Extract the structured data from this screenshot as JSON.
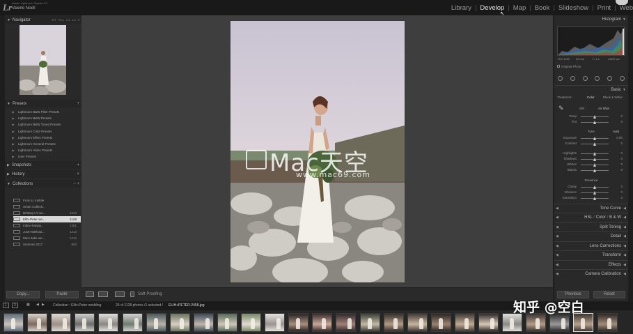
{
  "app": {
    "logo": "Lr",
    "version": "Adobe Lightroom Classic CC",
    "user": "Valerie Noell"
  },
  "modules": [
    "Library",
    "Develop",
    "Map",
    "Book",
    "Slideshow",
    "Print",
    "Web"
  ],
  "active_module": "Develop",
  "left_panel": {
    "navigator": {
      "title": "Navigator",
      "zoom": [
        "FIT",
        "FILL",
        "1:1",
        "4:1",
        "▾"
      ]
    },
    "presets": {
      "title": "Presets",
      "items": [
        "Lightroom B&W Filter Presets",
        "Lightroom B&W Presets",
        "Lightroom B&W Toned Presets",
        "Lightroom Color Presets",
        "Lightroom Effect Presets",
        "Lightroom General Presets",
        "Lightroom Video Presets",
        "User Presets"
      ]
    },
    "snapshots": {
      "title": "Snapshots",
      "action": "+"
    },
    "history": {
      "title": "History",
      "action": "×"
    },
    "collections": {
      "title": "Collections",
      "actions": "− +",
      "items": [
        {
          "name": "From Lr mobile",
          "count": ""
        },
        {
          "name": "Smart Collecti...",
          "count": ""
        },
        {
          "name": "Brittany+Al we...",
          "count": "1040"
        },
        {
          "name": "Elih+Peter we...",
          "count": "1128"
        },
        {
          "name": "India+Sanjay...",
          "count": "1381"
        },
        {
          "name": "Josh+Melissa...",
          "count": "1213"
        },
        {
          "name": "Max+Jake we...",
          "count": "1415"
        },
        {
          "name": "Summer 2017",
          "count": "883"
        }
      ],
      "selected_index": 3
    },
    "copy_label": "Copy...",
    "paste_label": "Paste"
  },
  "toolbar": {
    "soft_proofing_label": "Soft Proofing"
  },
  "watermark": {
    "text": "Mac天空",
    "url": "www.mac69.com"
  },
  "right_panel": {
    "histogram": {
      "title": "Histogram",
      "info": [
        "ISO 1250",
        "35 mm",
        "f / 1.1",
        "1/800 sec"
      ],
      "original_photo_label": "Original Photo"
    },
    "basic": {
      "title": "Basic",
      "treatment_label": "Treatment :",
      "treatment_color": "Color",
      "treatment_bw": "Black & White",
      "wb_label": "WB :",
      "wb_value": "As Shot",
      "temp_sliders": [
        {
          "label": "Temp",
          "value": "0"
        },
        {
          "label": "Tint",
          "value": "0"
        }
      ],
      "tone_label": "Tone",
      "auto_label": "Auto",
      "tone_sliders": [
        {
          "label": "Exposure",
          "value": "0.00"
        },
        {
          "label": "Contrast",
          "value": "0"
        },
        {
          "label": "Highlights",
          "value": "0"
        },
        {
          "label": "Shadows",
          "value": "0"
        },
        {
          "label": "Whites",
          "value": "0"
        },
        {
          "label": "Blacks",
          "value": "0"
        }
      ],
      "presence_label": "Presence",
      "presence_sliders": [
        {
          "label": "Clarity",
          "value": "0"
        },
        {
          "label": "Vibrance",
          "value": "0"
        },
        {
          "label": "Saturation",
          "value": "0"
        }
      ]
    },
    "sections": [
      "Tone Curve",
      "HSL / Color / B&W",
      "Split Toning",
      "Detail",
      "Lens Corrections",
      "Transform",
      "Effects",
      "Camera Calibration"
    ],
    "hsl_parts": [
      "HSL",
      "Color",
      "B & W"
    ],
    "previous_label": "Previous",
    "reset_label": "Reset"
  },
  "filmstrip": {
    "page_numbers": [
      "1",
      "2"
    ],
    "collection_text": "Collection : Elih+Peter wedding",
    "count_text": "25 of 1128 photos /1 selected /",
    "filename": "ELIH+PETER-2458.jpg",
    "thumb_count": 26
  },
  "overlay_brand": "知乎 @空白",
  "colors": {
    "accent_text": "#e6e6e6",
    "panel_bg": "#292929",
    "canvas_bg": "#3e3e3e"
  }
}
